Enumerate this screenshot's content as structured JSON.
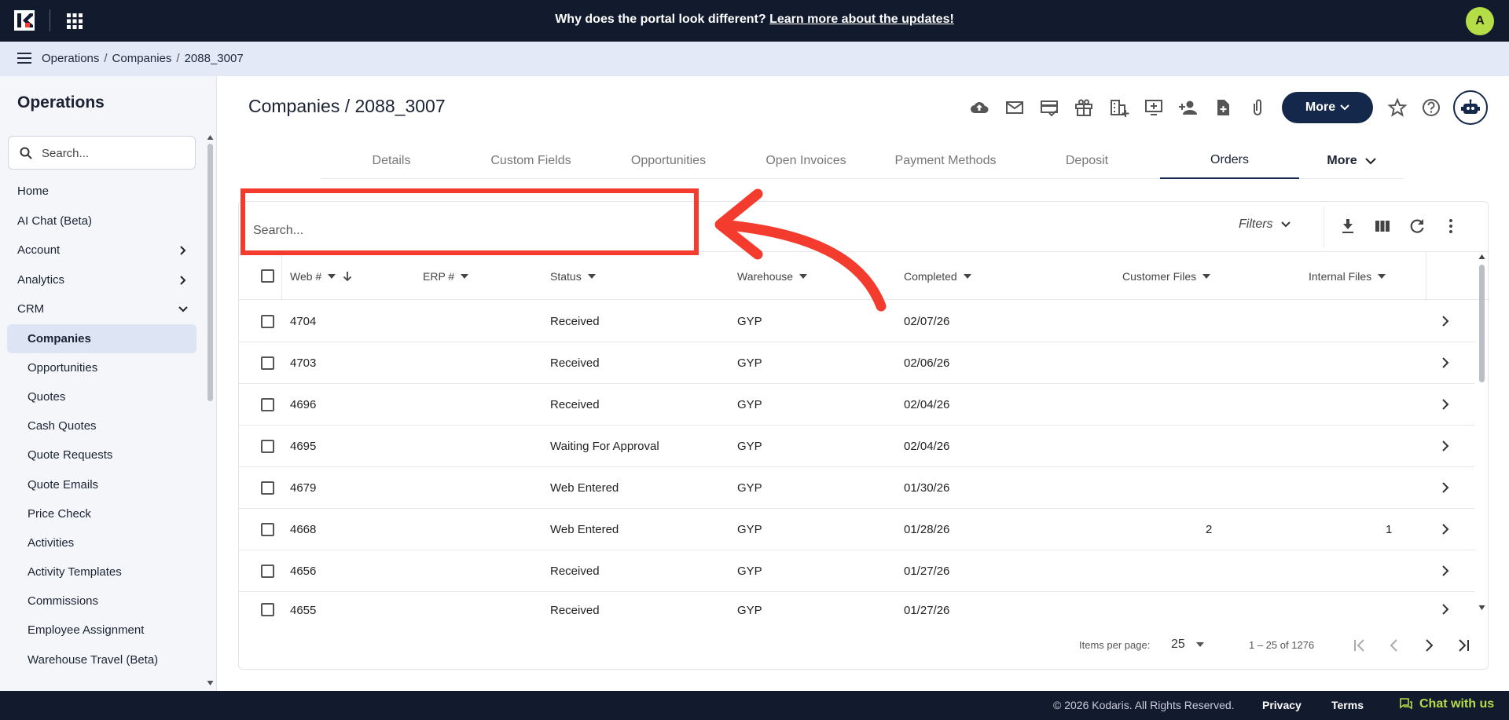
{
  "banner": {
    "text": "Why does the portal look different?",
    "link": "Learn more about the updates!",
    "avatar_letter": "A"
  },
  "breadcrumb": [
    "Operations",
    "Companies",
    "2088_3007"
  ],
  "sidebar": {
    "title": "Operations",
    "search_placeholder": "Search...",
    "items": [
      {
        "label": "Home",
        "sub": false,
        "chevron": ""
      },
      {
        "label": "AI Chat (Beta)",
        "sub": false,
        "chevron": ""
      },
      {
        "label": "Account",
        "sub": false,
        "chevron": "right"
      },
      {
        "label": "Analytics",
        "sub": false,
        "chevron": "right"
      },
      {
        "label": "CRM",
        "sub": false,
        "chevron": "down"
      },
      {
        "label": "Companies",
        "sub": true,
        "active": true
      },
      {
        "label": "Opportunities",
        "sub": true
      },
      {
        "label": "Quotes",
        "sub": true
      },
      {
        "label": "Cash Quotes",
        "sub": true
      },
      {
        "label": "Quote Requests",
        "sub": true
      },
      {
        "label": "Quote Emails",
        "sub": true
      },
      {
        "label": "Price Check",
        "sub": true
      },
      {
        "label": "Activities",
        "sub": true
      },
      {
        "label": "Activity Templates",
        "sub": true
      },
      {
        "label": "Commissions",
        "sub": true
      },
      {
        "label": "Employee Assignment",
        "sub": true
      },
      {
        "label": "Warehouse Travel (Beta)",
        "sub": true
      }
    ]
  },
  "header": {
    "title": "Companies / 2088_3007",
    "more_label": "More",
    "toolbar_icons": [
      "cloud-upload-icon",
      "mail-icon",
      "card-check-icon",
      "gift-icon",
      "company-add-icon",
      "screen-add-icon",
      "person-add-icon",
      "file-add-icon",
      "attachment-icon"
    ]
  },
  "tabs": [
    {
      "label": "Details"
    },
    {
      "label": "Custom Fields"
    },
    {
      "label": "Opportunities"
    },
    {
      "label": "Open Invoices"
    },
    {
      "label": "Payment Methods"
    },
    {
      "label": "Deposit"
    },
    {
      "label": "Orders",
      "active": true
    },
    {
      "label": "More"
    }
  ],
  "table": {
    "search_placeholder": "Search...",
    "filters_label": "Filters",
    "columns": [
      "Web #",
      "ERP #",
      "Status",
      "Warehouse",
      "Completed",
      "Customer Files",
      "Internal Files"
    ],
    "rows": [
      [
        "4704",
        "",
        "Received",
        "GYP",
        "02/07/26",
        "",
        ""
      ],
      [
        "4703",
        "",
        "Received",
        "GYP",
        "02/06/26",
        "",
        ""
      ],
      [
        "4696",
        "",
        "Received",
        "GYP",
        "02/04/26",
        "",
        ""
      ],
      [
        "4695",
        "",
        "Waiting For Approval",
        "GYP",
        "02/04/26",
        "",
        ""
      ],
      [
        "4679",
        "",
        "Web Entered",
        "GYP",
        "01/30/26",
        "",
        ""
      ],
      [
        "4668",
        "",
        "Web Entered",
        "GYP",
        "01/28/26",
        "2",
        "1"
      ],
      [
        "4656",
        "",
        "Received",
        "GYP",
        "01/27/26",
        "",
        ""
      ],
      [
        "4655",
        "",
        "Received",
        "GYP",
        "01/27/26",
        "",
        ""
      ]
    ],
    "paginator": {
      "items_per_page_label": "Items per page:",
      "page_size": "25",
      "range": "1 – 25 of 1276"
    }
  },
  "footer": {
    "copyright": "© 2026 Kodaris. All Rights Reserved.",
    "privacy": "Privacy",
    "terms": "Terms",
    "chat": "Chat with us"
  },
  "colors": {
    "navy": "#121a2e",
    "brand_button": "#14284b",
    "accent_green": "#b5dd47",
    "annotation_red": "#f33b2e"
  }
}
